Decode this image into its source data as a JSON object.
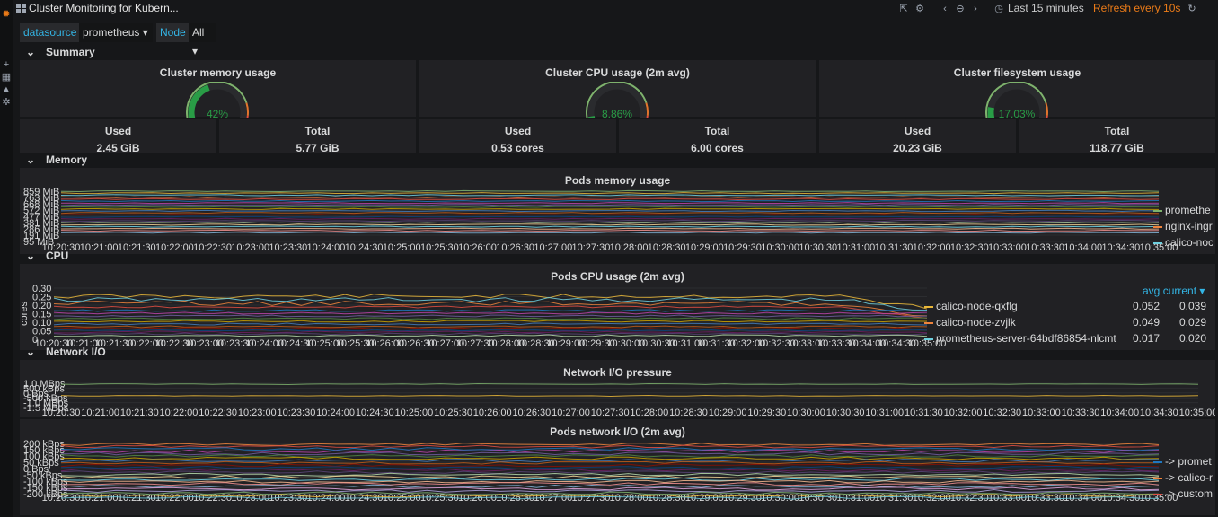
{
  "app": {
    "title": "Cluster Monitoring for Kubern..."
  },
  "toolbar": {
    "time_range": "Last 15 minutes",
    "refresh": "Refresh every 10s"
  },
  "variables": [
    {
      "label": "datasource",
      "value": "prometheus"
    },
    {
      "label": "Node",
      "value": "All"
    }
  ],
  "rows": {
    "summary": "Summary",
    "memory": "Memory",
    "cpu": "CPU",
    "network": "Network I/O"
  },
  "summary": {
    "gauges": [
      {
        "title": "Cluster memory usage",
        "value": "42%",
        "percent": 42
      },
      {
        "title": "Cluster CPU usage (2m avg)",
        "value": "8.86%",
        "percent": 8.86
      },
      {
        "title": "Cluster filesystem usage",
        "value": "17.03%",
        "percent": 17.03
      }
    ],
    "stats": [
      {
        "label": "Used",
        "value": "2.45 GiB"
      },
      {
        "label": "Total",
        "value": "5.77 GiB"
      },
      {
        "label": "Used",
        "value": "0.53 cores"
      },
      {
        "label": "Total",
        "value": "6.00 cores"
      },
      {
        "label": "Used",
        "value": "20.23 GiB"
      },
      {
        "label": "Total",
        "value": "118.77 GiB"
      }
    ]
  },
  "x_ticks": [
    "10:20:30",
    "10:21:00",
    "10:21:30",
    "10:22:00",
    "10:22:30",
    "10:23:00",
    "10:23:30",
    "10:24:00",
    "10:24:30",
    "10:25:00",
    "10:25:30",
    "10:26:00",
    "10:26:30",
    "10:27:00",
    "10:27:30",
    "10:28:00",
    "10:28:30",
    "10:29:00",
    "10:29:30",
    "10:30:00",
    "10:30:30",
    "10:31:00",
    "10:31:30",
    "10:32:00",
    "10:32:30",
    "10:33:00",
    "10:33:30",
    "10:34:00",
    "10:34:30",
    "10:35:00"
  ],
  "memory_panel": {
    "title": "Pods memory usage",
    "y_ticks": [
      "859 MiB",
      "763 MiB",
      "668 MiB",
      "572 MiB",
      "477 MiB",
      "381 MiB",
      "286 MiB",
      "191 MiB",
      "95 MiB"
    ],
    "legend": [
      {
        "name": "promethe",
        "color": "#7eb26d"
      },
      {
        "name": "nginx-ingr",
        "color": "#ef843c"
      },
      {
        "name": "calico-noc",
        "color": "#6ed0e0"
      }
    ]
  },
  "cpu_panel": {
    "title": "Pods CPU usage (2m avg)",
    "y_label": "cores",
    "y_ticks": [
      "0.30",
      "0.25",
      "0.20",
      "0.15",
      "0.10",
      "0.05",
      "0"
    ],
    "legend_headers": [
      "avg",
      "current"
    ],
    "legend": [
      {
        "name": "calico-node-qxflg",
        "avg": "0.052",
        "current": "0.039",
        "color": "#eab839"
      },
      {
        "name": "calico-node-zvjlk",
        "avg": "0.049",
        "current": "0.029",
        "color": "#ef843c"
      },
      {
        "name": "prometheus-server-64bdf86854-nlcmt",
        "avg": "0.017",
        "current": "0.020",
        "color": "#6ed0e0"
      }
    ]
  },
  "net_pressure_panel": {
    "title": "Network I/O pressure",
    "y_ticks": [
      "1.0 MBps",
      "500 kBps",
      "0 Bps",
      "-500 kBps",
      "-1.0 MBps",
      "-1.5 MBps"
    ]
  },
  "net_pods_panel": {
    "title": "Pods network I/O (2m avg)",
    "y_ticks": [
      "200 kBps",
      "150 kBps",
      "100 kBps",
      "50 kBps",
      "0 Bps",
      "-50 kBps",
      "-100 kBps",
      "-150 kBps",
      "-200 kBps"
    ],
    "legend": [
      {
        "name": "-> promet",
        "color": "#1f78c1"
      },
      {
        "name": "-> calico-r",
        "color": "#ef843c"
      },
      {
        "name": "-> custom",
        "color": "#e24d42"
      }
    ]
  }
}
